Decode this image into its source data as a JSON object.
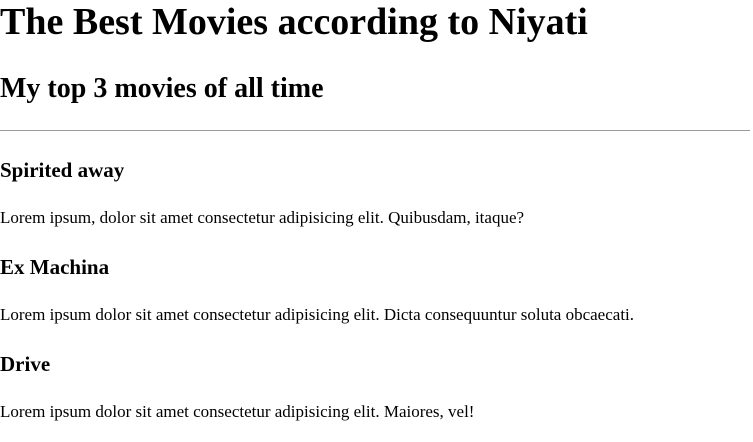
{
  "page": {
    "title": "The Best Movies according to Niyati",
    "subtitle": "My top 3 movies of all time"
  },
  "movies": [
    {
      "title": "Spirited away",
      "description": "Lorem ipsum, dolor sit amet consectetur adipisicing elit. Quibusdam, itaque?"
    },
    {
      "title": "Ex Machina",
      "description": "Lorem ipsum dolor sit amet consectetur adipisicing elit. Dicta consequuntur soluta obcaecati."
    },
    {
      "title": "Drive",
      "description": "Lorem ipsum dolor sit amet consectetur adipisicing elit. Maiores, vel!"
    }
  ]
}
